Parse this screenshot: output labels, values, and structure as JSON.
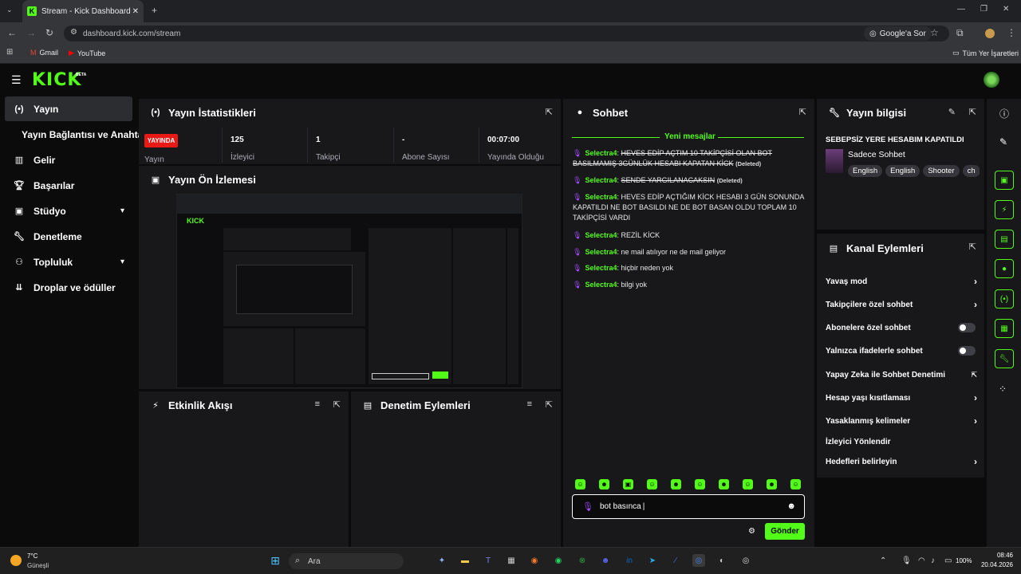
{
  "browser": {
    "tab_title": "Stream - Kick Dashboard",
    "url": "dashboard.kick.com/stream",
    "google_button": "Google'a Sor",
    "bookmarks": [
      "Gmail",
      "YouTube"
    ],
    "all_bookmarks": "Tüm Yer İşaretleri"
  },
  "app": {
    "logo": "KICK",
    "beta": "BETA"
  },
  "sidebar": {
    "items": [
      {
        "label": "Yayın"
      },
      {
        "label": "Yayın Bağlantısı ve Anahtarı"
      },
      {
        "label": "Gelir"
      },
      {
        "label": "Başarılar"
      },
      {
        "label": "Stüdyo"
      },
      {
        "label": "Denetleme"
      },
      {
        "label": "Topluluk"
      },
      {
        "label": "Droplar ve ödüller"
      }
    ]
  },
  "stats": {
    "title": "Yayın İstatistikleri",
    "live_badge": "YAYINDA",
    "live_label": "Yayın",
    "viewers_value": "125",
    "viewers_label": "İzleyici",
    "followers_value": "1",
    "followers_label": "Takipçi",
    "subs_value": "-",
    "subs_label": "Abone Sayısı",
    "uptime_value": "00:07:00",
    "uptime_label": "Yayında Olduğu"
  },
  "preview": {
    "title": "Yayın Ön İzlemesi"
  },
  "activity": {
    "title": "Etkinlik Akışı"
  },
  "moderation": {
    "title": "Denetim Eylemleri"
  },
  "chat": {
    "title": "Sohbet",
    "new_messages": "Yeni mesajlar",
    "messages": [
      {
        "user": "Selectra4",
        "text": "HEVES EDİP AÇTIM 10 TAKİPÇİSİ OLAN BOT BASILMAMIŞ 3GÜNLÜK HESABI KAPATAN KİCK",
        "deleted": "(Deleted)"
      },
      {
        "user": "Selectra4",
        "text": "SENDE YARGILANACAKSIN",
        "deleted": "(Deleted)"
      },
      {
        "user": "Selectra4",
        "text": "HEVES EDİP AÇTIĞIM KİCK HESABI 3 GÜN SONUNDA KAPATILDI NE BOT BASILDI NE DE BOT BASAN OLDU TOPLAM 10 TAKİPÇİSİ VARDI"
      },
      {
        "user": "Selectra4",
        "text": "REZİL KİCK"
      },
      {
        "user": "Selectra4",
        "text": "ne mail atılıyor ne de mail geliyor"
      },
      {
        "user": "Selectra4",
        "text": "hiçbir neden yok"
      },
      {
        "user": "Selectra4",
        "text": "bilgi yok"
      }
    ],
    "input_value": "bot basınca",
    "send_label": "Gönder"
  },
  "stream_info": {
    "title": "Yayın bilgisi",
    "stream_title": "SEBEPSİZ YERE HESABIM KAPATILDI",
    "category": "Sadece Sohbet",
    "tags": [
      "English",
      "English",
      "Shooter",
      "ch"
    ]
  },
  "channel_actions": {
    "title": "Kanal Eylemleri",
    "items": [
      {
        "label": "Yavaş mod"
      },
      {
        "label": "Takipçilere özel sohbet"
      },
      {
        "label": "Abonelere özel sohbet"
      },
      {
        "label": "Yalnızca ifadelerle sohbet"
      },
      {
        "label": "Yapay Zeka ile Sohbet Denetimi"
      },
      {
        "label": "Hesap yaşı kısıtlaması"
      },
      {
        "label": "Yasaklanmış kelimeler"
      },
      {
        "label": "İzleyici Yönlendir"
      },
      {
        "label": "Hedefleri belirleyin"
      }
    ]
  },
  "taskbar": {
    "weather_temp": "7°C",
    "weather_desc": "Güneşli",
    "search": "Ara",
    "battery": "100%",
    "time": "08:46",
    "date": "20.04.2026"
  }
}
